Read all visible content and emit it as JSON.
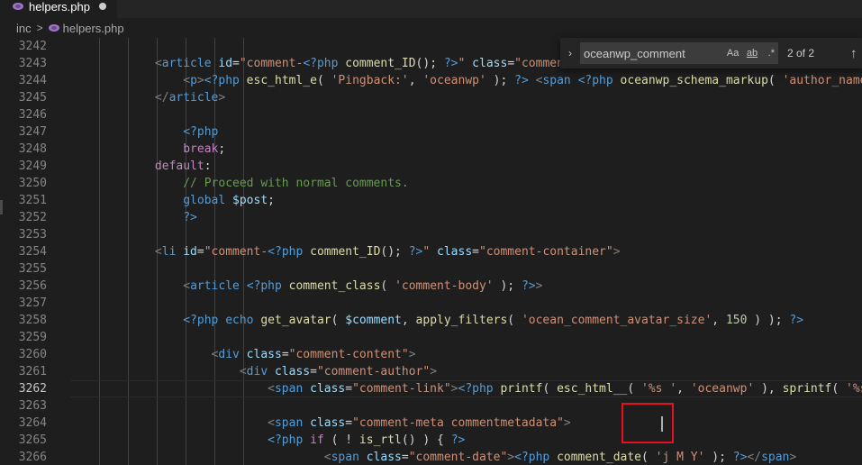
{
  "tab": {
    "file_name": "helpers.php",
    "unsaved": true
  },
  "breadcrumb": {
    "folder": "inc",
    "separator": ">",
    "file_name": "helpers.php"
  },
  "find_widget": {
    "query": "oceanwp_comment",
    "match_case_label": "Aa",
    "whole_word_label": "ab",
    "regex_label": ".*",
    "result_count": "2 of 2",
    "prev_label": "↑"
  },
  "editor": {
    "current_line": "3262",
    "lines": [
      {
        "number": "3242",
        "tokens": []
      },
      {
        "number": "3243",
        "tokens": [
          {
            "t": "            ",
            "c": "plain"
          },
          {
            "t": "<",
            "c": "tag"
          },
          {
            "t": "article",
            "c": "tagname"
          },
          {
            "t": " id",
            "c": "attr"
          },
          {
            "t": "=",
            "c": "plain"
          },
          {
            "t": "\"comment-",
            "c": "str"
          },
          {
            "t": "<?php",
            "c": "php"
          },
          {
            "t": " comment_ID",
            "c": "fn"
          },
          {
            "t": "(); ",
            "c": "plain"
          },
          {
            "t": "?>",
            "c": "php"
          },
          {
            "t": "\"",
            "c": "str"
          },
          {
            "t": " class",
            "c": "attr"
          },
          {
            "t": "=",
            "c": "plain"
          },
          {
            "t": "\"comment",
            "c": "str"
          }
        ]
      },
      {
        "number": "3244",
        "tokens": [
          {
            "t": "                ",
            "c": "plain"
          },
          {
            "t": "<",
            "c": "tag"
          },
          {
            "t": "p",
            "c": "tagname"
          },
          {
            "t": ">",
            "c": "tag"
          },
          {
            "t": "<?php",
            "c": "php"
          },
          {
            "t": " esc_html_e",
            "c": "fn"
          },
          {
            "t": "( ",
            "c": "plain"
          },
          {
            "t": "'Pingback:'",
            "c": "str"
          },
          {
            "t": ", ",
            "c": "plain"
          },
          {
            "t": "'oceanwp'",
            "c": "str"
          },
          {
            "t": " ); ",
            "c": "plain"
          },
          {
            "t": "?>",
            "c": "php"
          },
          {
            "t": " ",
            "c": "plain"
          },
          {
            "t": "<",
            "c": "tag"
          },
          {
            "t": "span",
            "c": "tagname"
          },
          {
            "t": " ",
            "c": "plain"
          },
          {
            "t": "<?php",
            "c": "php"
          },
          {
            "t": " oceanwp_schema_markup",
            "c": "fn"
          },
          {
            "t": "( ",
            "c": "plain"
          },
          {
            "t": "'author_name'",
            "c": "str"
          }
        ]
      },
      {
        "number": "3245",
        "tokens": [
          {
            "t": "            ",
            "c": "plain"
          },
          {
            "t": "</",
            "c": "tag"
          },
          {
            "t": "article",
            "c": "tagname"
          },
          {
            "t": ">",
            "c": "tag"
          }
        ]
      },
      {
        "number": "3246",
        "tokens": []
      },
      {
        "number": "3247",
        "tokens": [
          {
            "t": "                ",
            "c": "plain"
          },
          {
            "t": "<?php",
            "c": "php"
          }
        ]
      },
      {
        "number": "3248",
        "tokens": [
          {
            "t": "                ",
            "c": "plain"
          },
          {
            "t": "break",
            "c": "kw"
          },
          {
            "t": ";",
            "c": "plain"
          }
        ]
      },
      {
        "number": "3249",
        "tokens": [
          {
            "t": "            ",
            "c": "plain"
          },
          {
            "t": "default",
            "c": "kw"
          },
          {
            "t": ":",
            "c": "plain"
          }
        ]
      },
      {
        "number": "3250",
        "tokens": [
          {
            "t": "                ",
            "c": "plain"
          },
          {
            "t": "// Proceed with normal comments.",
            "c": "cmt"
          }
        ]
      },
      {
        "number": "3251",
        "tokens": [
          {
            "t": "                ",
            "c": "plain"
          },
          {
            "t": "global",
            "c": "php"
          },
          {
            "t": " ",
            "c": "plain"
          },
          {
            "t": "$post",
            "c": "var"
          },
          {
            "t": ";",
            "c": "plain"
          }
        ]
      },
      {
        "number": "3252",
        "tokens": [
          {
            "t": "                ",
            "c": "plain"
          },
          {
            "t": "?>",
            "c": "php"
          }
        ]
      },
      {
        "number": "3253",
        "tokens": []
      },
      {
        "number": "3254",
        "tokens": [
          {
            "t": "            ",
            "c": "plain"
          },
          {
            "t": "<",
            "c": "tag"
          },
          {
            "t": "li",
            "c": "tagname"
          },
          {
            "t": " id",
            "c": "attr"
          },
          {
            "t": "=",
            "c": "plain"
          },
          {
            "t": "\"comment-",
            "c": "str"
          },
          {
            "t": "<?php",
            "c": "php"
          },
          {
            "t": " comment_ID",
            "c": "fn"
          },
          {
            "t": "(); ",
            "c": "plain"
          },
          {
            "t": "?>",
            "c": "php"
          },
          {
            "t": "\"",
            "c": "str"
          },
          {
            "t": " class",
            "c": "attr"
          },
          {
            "t": "=",
            "c": "plain"
          },
          {
            "t": "\"comment-container\"",
            "c": "str"
          },
          {
            "t": ">",
            "c": "tag"
          }
        ]
      },
      {
        "number": "3255",
        "tokens": []
      },
      {
        "number": "3256",
        "tokens": [
          {
            "t": "                ",
            "c": "plain"
          },
          {
            "t": "<",
            "c": "tag"
          },
          {
            "t": "article",
            "c": "tagname"
          },
          {
            "t": " ",
            "c": "plain"
          },
          {
            "t": "<?php",
            "c": "php"
          },
          {
            "t": " comment_class",
            "c": "fn"
          },
          {
            "t": "( ",
            "c": "plain"
          },
          {
            "t": "'comment-body'",
            "c": "str"
          },
          {
            "t": " ); ",
            "c": "plain"
          },
          {
            "t": "?>",
            "c": "php"
          },
          {
            "t": ">",
            "c": "tag"
          }
        ]
      },
      {
        "number": "3257",
        "tokens": []
      },
      {
        "number": "3258",
        "tokens": [
          {
            "t": "                ",
            "c": "plain"
          },
          {
            "t": "<?php",
            "c": "php"
          },
          {
            "t": " echo",
            "c": "php"
          },
          {
            "t": " get_avatar",
            "c": "fn"
          },
          {
            "t": "( ",
            "c": "plain"
          },
          {
            "t": "$comment",
            "c": "var"
          },
          {
            "t": ", ",
            "c": "plain"
          },
          {
            "t": "apply_filters",
            "c": "fn"
          },
          {
            "t": "( ",
            "c": "plain"
          },
          {
            "t": "'ocean_comment_avatar_size'",
            "c": "str"
          },
          {
            "t": ", ",
            "c": "plain"
          },
          {
            "t": "150",
            "c": "num"
          },
          {
            "t": " ) ); ",
            "c": "plain"
          },
          {
            "t": "?>",
            "c": "php"
          }
        ]
      },
      {
        "number": "3259",
        "tokens": []
      },
      {
        "number": "3260",
        "tokens": [
          {
            "t": "                    ",
            "c": "plain"
          },
          {
            "t": "<",
            "c": "tag"
          },
          {
            "t": "div",
            "c": "tagname"
          },
          {
            "t": " class",
            "c": "attr"
          },
          {
            "t": "=",
            "c": "plain"
          },
          {
            "t": "\"comment-content\"",
            "c": "str"
          },
          {
            "t": ">",
            "c": "tag"
          }
        ]
      },
      {
        "number": "3261",
        "tokens": [
          {
            "t": "                        ",
            "c": "plain"
          },
          {
            "t": "<",
            "c": "tag"
          },
          {
            "t": "div",
            "c": "tagname"
          },
          {
            "t": " class",
            "c": "attr"
          },
          {
            "t": "=",
            "c": "plain"
          },
          {
            "t": "\"comment-author\"",
            "c": "str"
          },
          {
            "t": ">",
            "c": "tag"
          }
        ]
      },
      {
        "number": "3262",
        "tokens": [
          {
            "t": "                            ",
            "c": "plain"
          },
          {
            "t": "<",
            "c": "tag"
          },
          {
            "t": "span",
            "c": "tagname"
          },
          {
            "t": " class",
            "c": "attr"
          },
          {
            "t": "=",
            "c": "plain"
          },
          {
            "t": "\"comment-link\"",
            "c": "str"
          },
          {
            "t": ">",
            "c": "tag"
          },
          {
            "t": "<?php",
            "c": "php"
          },
          {
            "t": " printf",
            "c": "fn"
          },
          {
            "t": "( ",
            "c": "plain"
          },
          {
            "t": "esc_html__",
            "c": "fn"
          },
          {
            "t": "( ",
            "c": "plain"
          },
          {
            "t": "'%s '",
            "c": "str"
          },
          {
            "t": ", ",
            "c": "plain"
          },
          {
            "t": "'oceanwp'",
            "c": "str"
          },
          {
            "t": " ), ",
            "c": "plain"
          },
          {
            "t": "sprintf",
            "c": "fn"
          },
          {
            "t": "( ",
            "c": "plain"
          },
          {
            "t": "'%s'",
            "c": "str"
          }
        ]
      },
      {
        "number": "3263",
        "tokens": []
      },
      {
        "number": "3264",
        "tokens": [
          {
            "t": "                            ",
            "c": "plain"
          },
          {
            "t": "<",
            "c": "tag"
          },
          {
            "t": "span",
            "c": "tagname"
          },
          {
            "t": " class",
            "c": "attr"
          },
          {
            "t": "=",
            "c": "plain"
          },
          {
            "t": "\"comment-meta commentmetadata\"",
            "c": "str"
          },
          {
            "t": ">",
            "c": "tag"
          }
        ]
      },
      {
        "number": "3265",
        "tokens": [
          {
            "t": "                            ",
            "c": "plain"
          },
          {
            "t": "<?php",
            "c": "php"
          },
          {
            "t": " if",
            "c": "kw"
          },
          {
            "t": " ( ! ",
            "c": "plain"
          },
          {
            "t": "is_rtl",
            "c": "fn"
          },
          {
            "t": "() ) { ",
            "c": "plain"
          },
          {
            "t": "?>",
            "c": "php"
          }
        ]
      },
      {
        "number": "3266",
        "tokens": [
          {
            "t": "                                    ",
            "c": "plain"
          },
          {
            "t": "<",
            "c": "tag"
          },
          {
            "t": "span",
            "c": "tagname"
          },
          {
            "t": " class",
            "c": "attr"
          },
          {
            "t": "=",
            "c": "plain"
          },
          {
            "t": "\"comment-date\"",
            "c": "str"
          },
          {
            "t": ">",
            "c": "tag"
          },
          {
            "t": "<?php",
            "c": "php"
          },
          {
            "t": " comment_date",
            "c": "fn"
          },
          {
            "t": "( ",
            "c": "plain"
          },
          {
            "t": "'j M Y'",
            "c": "str"
          },
          {
            "t": " ); ",
            "c": "plain"
          },
          {
            "t": "?>",
            "c": "php"
          },
          {
            "t": "</",
            "c": "tag"
          },
          {
            "t": "span",
            "c": "tagname"
          },
          {
            "t": ">",
            "c": "tag"
          }
        ]
      }
    ]
  },
  "colors": {
    "background": "#1e1e1e",
    "tab_bar": "#252526",
    "annotation_box": "#e81123"
  }
}
